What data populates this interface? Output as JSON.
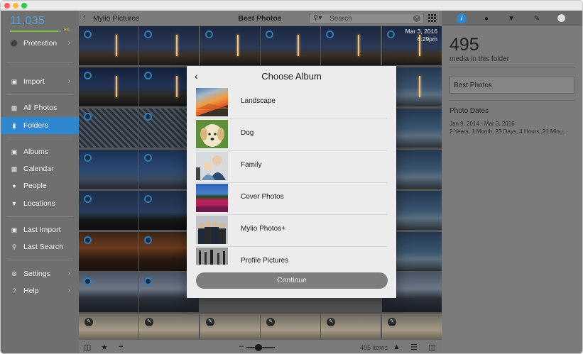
{
  "sidebar": {
    "media_count": "11,035",
    "storage_fill_fraction": 0.95,
    "storage_badge": "ES",
    "items": [
      {
        "label": "Protection",
        "icon": "shield-icon",
        "chevron": true
      },
      {
        "label": "Import",
        "icon": "import-icon",
        "chevron": true
      },
      {
        "label": "All Photos",
        "icon": "grid-icon",
        "chevron": false
      },
      {
        "label": "Folders",
        "icon": "folder-icon",
        "chevron": false,
        "active": true
      },
      {
        "label": "Albums",
        "icon": "album-icon",
        "chevron": false
      },
      {
        "label": "Calendar",
        "icon": "calendar-icon",
        "chevron": false
      },
      {
        "label": "People",
        "icon": "person-icon",
        "chevron": false
      },
      {
        "label": "Locations",
        "icon": "location-pin-icon",
        "chevron": false
      },
      {
        "label": "Last Import",
        "icon": "last-import-icon",
        "chevron": false
      },
      {
        "label": "Last Search",
        "icon": "search-icon",
        "chevron": false
      },
      {
        "label": "Settings",
        "icon": "gear-icon",
        "chevron": true
      },
      {
        "label": "Help",
        "icon": "help-icon",
        "chevron": true
      }
    ]
  },
  "toolbar": {
    "back_label": "Mylio Pictures",
    "title": "Best Photos",
    "search_placeholder": "Search"
  },
  "grid": {
    "first_tile_date": "Mar 3, 2016",
    "first_tile_time": "6:29pm"
  },
  "bottombar": {
    "items_count": "495 items"
  },
  "info_panel": {
    "media_count": "495",
    "media_caption": "media in this folder",
    "folder_name": "Best Photos",
    "photo_dates_heading": "Photo Dates",
    "date_range": "Jan 9, 2014 - Mar 3, 2016",
    "duration": "2 Years, 1 Month, 23 Days, 4 Hours, 21 Minu..."
  },
  "modal": {
    "title": "Choose Album",
    "albums": [
      {
        "label": "Landscape",
        "thumb": "landscape-sunset"
      },
      {
        "label": "Dog",
        "thumb": "dog-puppy"
      },
      {
        "label": "Family",
        "thumb": "family-portrait"
      },
      {
        "label": "Cover Photos",
        "thumb": "tulip-field"
      },
      {
        "label": "Mylio Photos+",
        "thumb": "group-portrait"
      },
      {
        "label": "Profile Pictures",
        "thumb": "black-white-scene"
      }
    ],
    "continue_label": "Continue"
  },
  "colors": {
    "accent": "#2f87cf",
    "sidebar_bg": "#6f6f6f",
    "storage_green": "#7ac943"
  }
}
